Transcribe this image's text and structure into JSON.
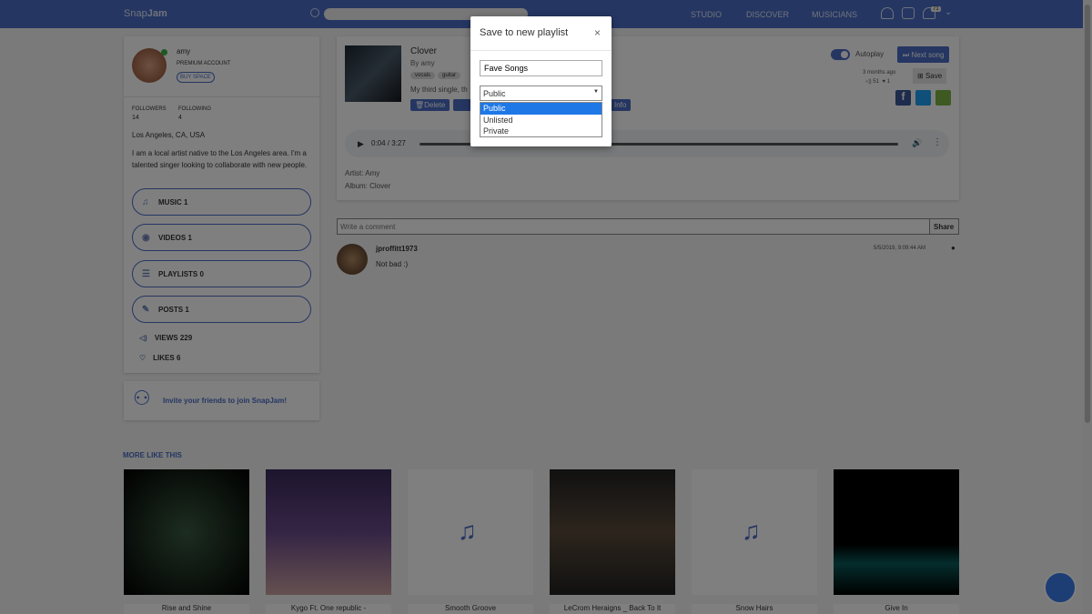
{
  "header": {
    "logo_a": "Snap",
    "logo_b": "Jam",
    "search_placeholder": "",
    "nav": [
      "STUDIO",
      "DISCOVER",
      "MUSICIANS"
    ],
    "notification_count": "71"
  },
  "profile": {
    "name": "amy",
    "account": "PREMIUM ACCOUNT",
    "buy_space": "BUY SPACE",
    "followers_label": "FOLLOWERS",
    "followers": "14",
    "following_label": "FOLLOWING",
    "following": "4",
    "location": "Los Angeles, CA, USA",
    "bio": "I am a local artist native to the Los Angeles area. I'm a talented singer looking to collaborate with new people.",
    "online_color": "#3cb043"
  },
  "sidebar": {
    "items": [
      {
        "label": "MUSIC 1",
        "icon": "music-note-icon"
      },
      {
        "label": "VIDEOS 1",
        "icon": "play-circle-icon"
      },
      {
        "label": "PLAYLISTS 0",
        "icon": "list-icon"
      },
      {
        "label": "POSTS 1",
        "icon": "pencil-icon"
      }
    ],
    "views": "VIEWS 229",
    "likes": "LIKES 6",
    "invite": "Invite your friends to join SnapJam!"
  },
  "song": {
    "title": "Clover",
    "by": "By amy",
    "tags": [
      "vocals",
      "guitar"
    ],
    "description": "My third single, th",
    "delete": "Delete",
    "info": "Info",
    "autoplay": "Autoplay",
    "autoplay_on": true,
    "next_song": "Next song",
    "age": "3 months ago",
    "plays": "51",
    "likes": "1",
    "save": "Save",
    "time": "0:04 / 3:27",
    "progress": 0.02,
    "artist": "Artist: Amy",
    "album": "Album: Clover"
  },
  "comments": {
    "placeholder": "Write a comment",
    "share": "Share",
    "items": [
      {
        "user": "jproffitt1973",
        "text": "Not bad :)",
        "date": "5/5/2019, 9:09:44 AM"
      }
    ]
  },
  "more": {
    "title": "MORE LIKE THIS",
    "items": [
      "Rise and Shine",
      "Kygo Ft. One republic -",
      "Smooth Groove",
      "LeCrom Heraigns _ Back To It",
      "Snow Hairs",
      "Give In"
    ]
  },
  "modal": {
    "title": "Save to new playlist",
    "name_value": "Fave Songs",
    "privacy_selected": "Public",
    "options": [
      "Public",
      "Unlisted",
      "Private"
    ]
  },
  "colors": {
    "brand": "#4a6cc4",
    "facebook": "#3b5998",
    "twitter": "#1da1f2",
    "share": "#7cb342"
  }
}
